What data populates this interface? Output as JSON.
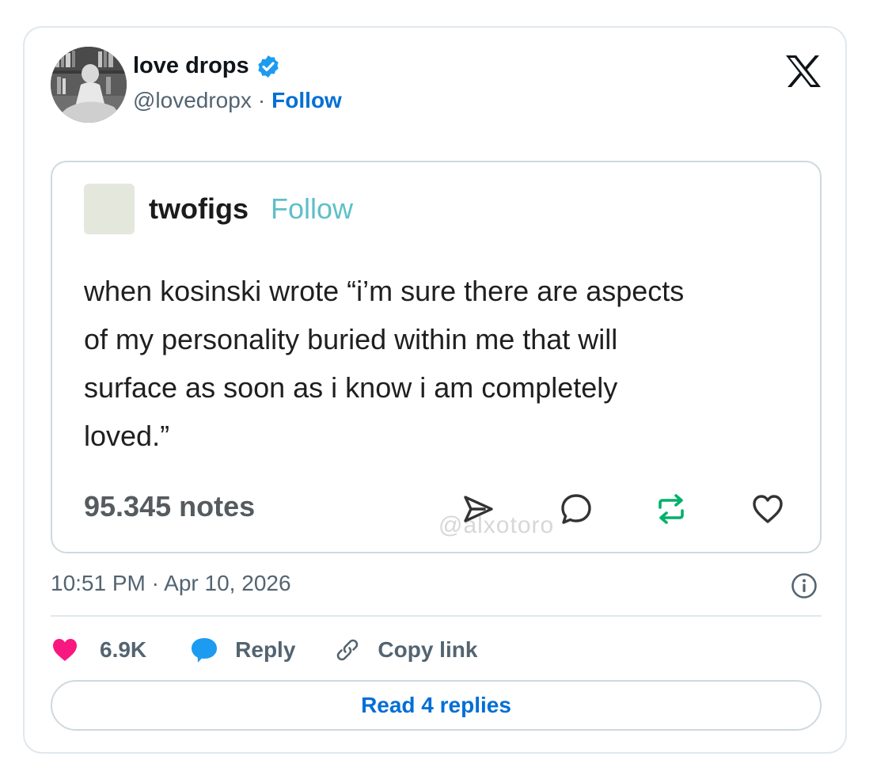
{
  "author": {
    "display_name": "love drops",
    "handle": "@lovedropx",
    "separator": "·",
    "follow_label": "Follow"
  },
  "embedded_post": {
    "username": "twofigs",
    "follow_label": "Follow",
    "body": "when kosinski wrote “i’m sure there are aspects\nof my personality buried within me that will\nsurface as soon as i know i am completely\nloved.”",
    "notes": "95.345 notes",
    "watermark": "@alxotoro"
  },
  "timestamp": "10:51 PM · Apr 10, 2026",
  "actions": {
    "like_count": "6.9K",
    "reply_label": "Reply",
    "copy_link_label": "Copy link"
  },
  "read_replies_label": "Read 4 replies",
  "colors": {
    "link_blue": "#006fd6",
    "verified_blue": "#1d9bf0",
    "like_pink": "#f91880",
    "reply_blue": "#1d9bf0",
    "reblog_green": "#00b16a",
    "tumblr_follow": "#5fbfc7",
    "muted_text": "#536471"
  },
  "icons": [
    "verified-badge-icon",
    "x-logo-icon",
    "share-icon",
    "comment-icon",
    "reblog-icon",
    "heart-outline-icon",
    "info-icon",
    "heart-icon",
    "reply-bubble-icon",
    "link-icon"
  ]
}
